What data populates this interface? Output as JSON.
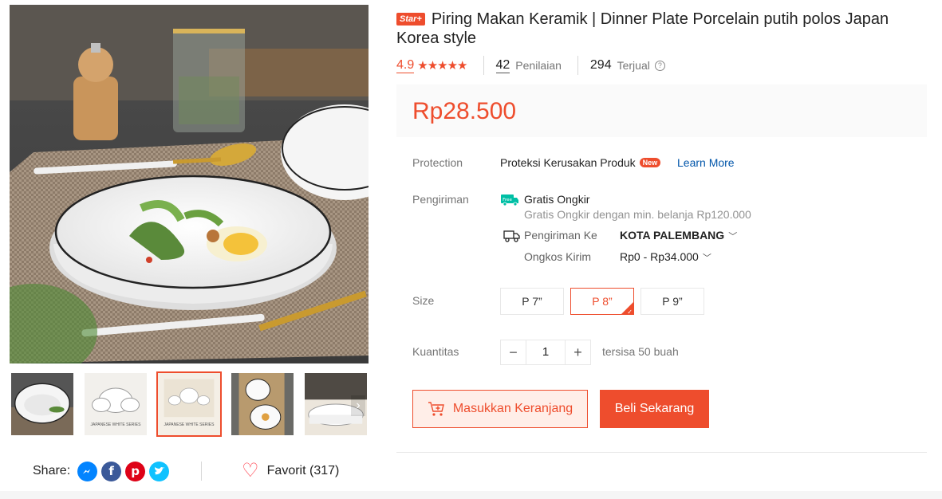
{
  "product": {
    "badge": "Star+",
    "title": "Piring Makan Keramik | Dinner Plate Porcelain putih polos Japan Korea style",
    "rating": "4.9",
    "stars": "★★★★★",
    "reviews_count": "42",
    "reviews_label": "Penilaian",
    "sold_count": "294",
    "sold_label": "Terjual",
    "price": "Rp28.500"
  },
  "gallery": {
    "thumbnails": [
      {
        "caption": ""
      },
      {
        "caption": "JAPANESE WHITE SERIES"
      },
      {
        "caption": "JAPANESE WHITE SERIES"
      },
      {
        "caption": ""
      },
      {
        "caption": ""
      }
    ],
    "active_index": 2
  },
  "protection": {
    "label": "Protection",
    "text": "Proteksi Kerusakan Produk",
    "badge": "New",
    "link": "Learn More"
  },
  "shipping": {
    "label": "Pengiriman",
    "free_badge": "Free",
    "free_title": "Gratis Ongkir",
    "free_subtitle": "Gratis Ongkir dengan min. belanja Rp120.000",
    "ship_to_label": "Pengiriman Ke",
    "ship_to_value": "KOTA PALEMBANG",
    "cost_label": "Ongkos Kirim",
    "cost_value": "Rp0 - Rp34.000"
  },
  "size": {
    "label": "Size",
    "options": [
      "P 7”",
      "P 8”",
      "P 9”"
    ],
    "selected": "P 8”"
  },
  "quantity": {
    "label": "Kuantitas",
    "value": "1",
    "minus": "−",
    "plus": "+",
    "stock": "tersisa 50 buah"
  },
  "actions": {
    "add_to_cart": "Masukkan Keranjang",
    "buy_now": "Beli Sekarang"
  },
  "share": {
    "label": "Share:",
    "networks": [
      "messenger",
      "facebook",
      "pinterest",
      "twitter"
    ]
  },
  "favorite": {
    "label": "Favorit (317)"
  },
  "colors": {
    "accent": "#ee4d2d",
    "link": "#0055aa",
    "free_shipping": "#00bfa5"
  }
}
